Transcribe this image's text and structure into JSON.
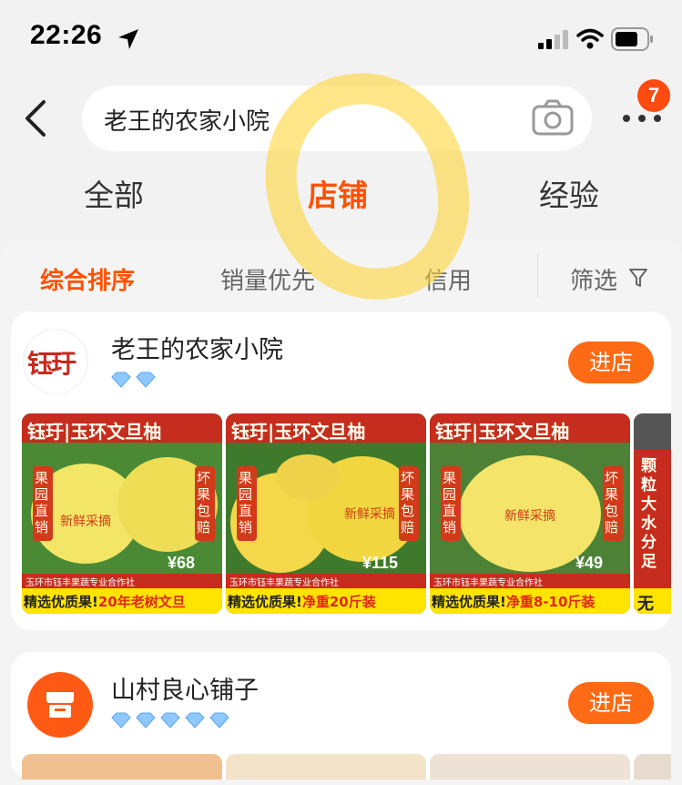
{
  "status_bar": {
    "time": "22:26"
  },
  "search": {
    "query": "老王的农家小院"
  },
  "notification": {
    "count": "7"
  },
  "tabs": [
    {
      "label": "全部"
    },
    {
      "label": "店铺"
    },
    {
      "label": "经验"
    }
  ],
  "subtabs": [
    {
      "label": "综合排序"
    },
    {
      "label": "销量优先"
    },
    {
      "label": "信用"
    },
    {
      "label": "筛选"
    }
  ],
  "stores": [
    {
      "name": "老王的农家小院",
      "logo_text": "钰玗",
      "enter_label": "进店",
      "products": [
        {
          "banner": "钰玗|玉环文旦柚",
          "left_tag": "果园直销",
          "right_tag": "坏果包赔",
          "center": "新鲜采摘",
          "coop": "玉环市钰丰果蔬专业合作社",
          "price": "¥68",
          "slogan": "精选优质果!",
          "slogan_red": "20年老树文旦"
        },
        {
          "banner": "钰玗|玉环文旦柚",
          "left_tag": "果园直销",
          "right_tag": "坏果包赔",
          "center": "新鲜采摘",
          "coop": "玉环市钰丰果蔬专业合作社",
          "price": "¥115",
          "slogan": "精选优质果!",
          "slogan_red": "净重20斤装"
        },
        {
          "banner": "钰玗|玉环文旦柚",
          "left_tag": "果园直销",
          "right_tag": "坏果包赔",
          "center": "新鲜采摘",
          "coop": "玉环市钰丰果蔬专业合作社",
          "price": "¥49",
          "slogan": "精选优质果!",
          "slogan_red": "净重8-10斤装"
        },
        {
          "side": "颗粒大水分足",
          "slogan": "无"
        }
      ]
    },
    {
      "name": "山村良心铺子",
      "enter_label": "进店"
    }
  ],
  "colors": {
    "accent": "#ff5000",
    "button": "#ff6a14",
    "highlight": "#ffd228"
  }
}
